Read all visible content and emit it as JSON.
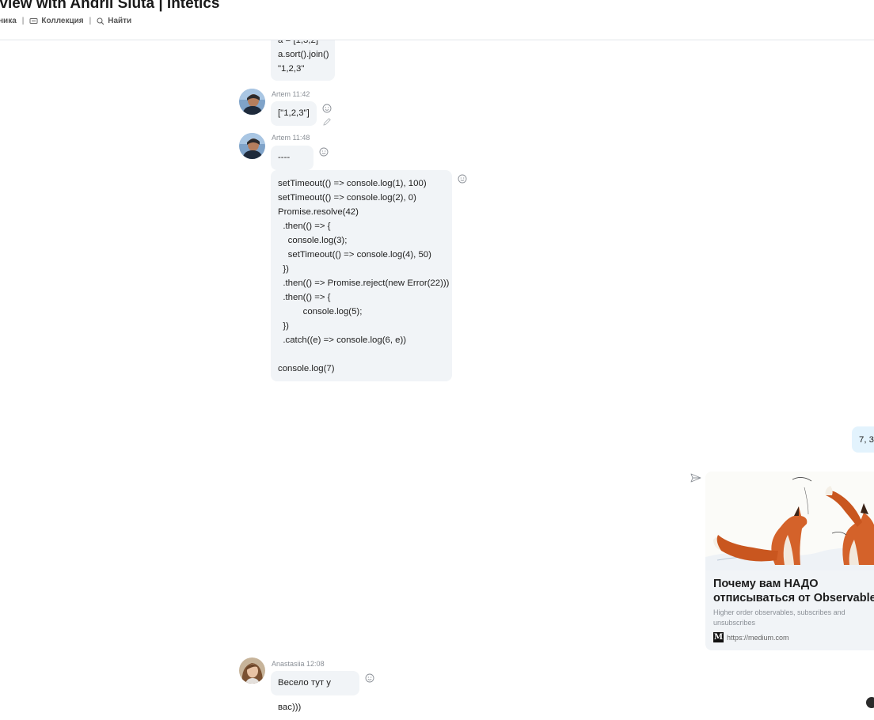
{
  "header": {
    "title": "rview with Andrii Siuta | Intetics",
    "toolbar": {
      "item1": "ника",
      "sep1": "|",
      "collection": "Коллекция",
      "sep2": "|",
      "search": "Найти"
    }
  },
  "messages": {
    "m0": {
      "lines": [
        "a = [1,3,2]",
        "a.sort().join()",
        "\"1,2,3\""
      ]
    },
    "m1": {
      "author": "Artem",
      "time": "11:42",
      "text": "[\"1,2,3\"]"
    },
    "m2": {
      "author": "Artem",
      "time": "11:48",
      "text": "----"
    },
    "m3": {
      "lines": [
        "setTimeout(() => console.log(1), 100)",
        "setTimeout(() => console.log(2), 0)",
        "Promise.resolve(42)",
        "  .then(() => {",
        "    console.log(3);",
        "    setTimeout(() => console.log(4), 50)",
        "  })",
        "  .then(() => Promise.reject(new Error(22)))",
        "  .then(() => {",
        "          console.log(5);",
        "  })",
        "  .catch((e) => console.log(6, e))",
        "",
        "console.log(7)"
      ]
    },
    "out1": {
      "text": "7, 3"
    },
    "link_card": {
      "title": "Почему вам НАДО\nотписываться от Observable",
      "description": "Higher order observables, subscribes and unsubscribes",
      "site": "https://medium.com",
      "logo_letter": "M"
    },
    "m4": {
      "author": "Anastasiia",
      "time": "12:08",
      "text": "Весело тут у вас)))"
    }
  },
  "colors": {
    "incoming_bubble": "#f1f4f7",
    "outgoing_bubble": "#e3f3fd",
    "meta_text": "#8a8f96"
  },
  "icons": [
    "bookmark-icon",
    "search-icon",
    "emoji-icon",
    "edit-icon",
    "send-icon",
    "medium-logo-icon"
  ]
}
